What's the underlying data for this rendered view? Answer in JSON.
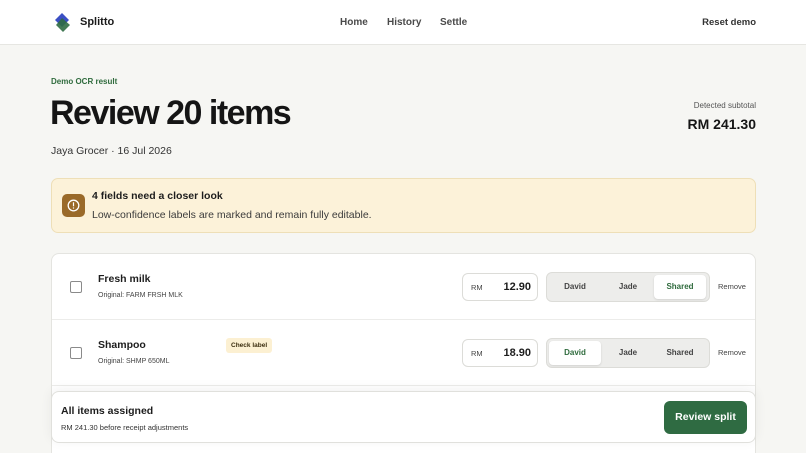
{
  "header": {
    "brand": "Splitto",
    "nav": [
      "Home",
      "History",
      "Settle"
    ],
    "reset_label": "Reset demo"
  },
  "page": {
    "eyebrow": "Demo OCR result",
    "title": "Review 20 items",
    "meta": "Jaya Grocer · 16 Jul 2026",
    "subtotal_label": "Detected subtotal",
    "subtotal_value": "RM 241.30"
  },
  "alert": {
    "title": "4 fields need a closer look",
    "text": "Low-confidence labels are marked and remain fully editable.",
    "icon": "info-icon"
  },
  "items": [
    {
      "name": "Fresh milk",
      "original": "Original: FARM FRSH MLK",
      "currency": "RM",
      "price": "12.90",
      "badge": "",
      "assign_options": [
        "David",
        "Jade",
        "Shared"
      ],
      "selected": "Shared",
      "remove_label": "Remove"
    },
    {
      "name": "Shampoo",
      "original": "Original: SHMP 650ML",
      "currency": "RM",
      "price": "18.90",
      "badge": "Check label",
      "assign_options": [
        "David",
        "Jade",
        "Shared"
      ],
      "selected": "David",
      "remove_label": "Remove"
    }
  ],
  "footer": {
    "title": "All items assigned",
    "subtitle": "RM 241.30 before receipt adjustments",
    "button_label": "Review split"
  },
  "colors": {
    "accent_green": "#2f6b42",
    "alert_bg": "#fcf2d9",
    "alert_icon": "#9a6a29"
  }
}
